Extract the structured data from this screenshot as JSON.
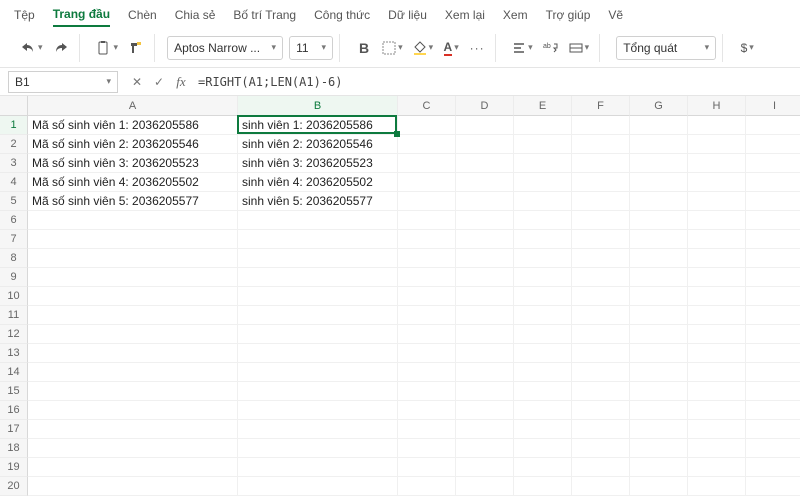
{
  "menu": {
    "items": [
      {
        "label": "Tệp"
      },
      {
        "label": "Trang đầu",
        "active": true
      },
      {
        "label": "Chèn"
      },
      {
        "label": "Chia sẻ"
      },
      {
        "label": "Bố trí Trang"
      },
      {
        "label": "Công thức"
      },
      {
        "label": "Dữ liệu"
      },
      {
        "label": "Xem lại"
      },
      {
        "label": "Xem"
      },
      {
        "label": "Trợ giúp"
      },
      {
        "label": "Vẽ"
      }
    ]
  },
  "ribbon": {
    "font_name": "Aptos Narrow ...",
    "font_size": "11",
    "number_format": "Tổng quát",
    "dollar": "$"
  },
  "formula_bar": {
    "name_box": "B1",
    "fx_label": "fx",
    "formula": "=RIGHT(A1;LEN(A1)-6)"
  },
  "grid": {
    "columns": [
      "A",
      "B",
      "C",
      "D",
      "E",
      "F",
      "G",
      "H",
      "I"
    ],
    "row_count": 20,
    "active": {
      "col": "B",
      "row": 1
    },
    "cells": {
      "A1": "Mã số sinh viên 1: 2036205586",
      "A2": "Mã số sinh viên 2: 2036205546",
      "A3": "Mã số sinh viên 3: 2036205523",
      "A4": "Mã số sinh viên 4: 2036205502",
      "A5": "Mã số sinh viên 5: 2036205577",
      "B1": "sinh viên 1: 2036205586",
      "B2": "sinh viên 2: 2036205546",
      "B3": "sinh viên 3: 2036205523",
      "B4": "sinh viên 4: 2036205502",
      "B5": "sinh viên 5: 2036205577"
    }
  }
}
